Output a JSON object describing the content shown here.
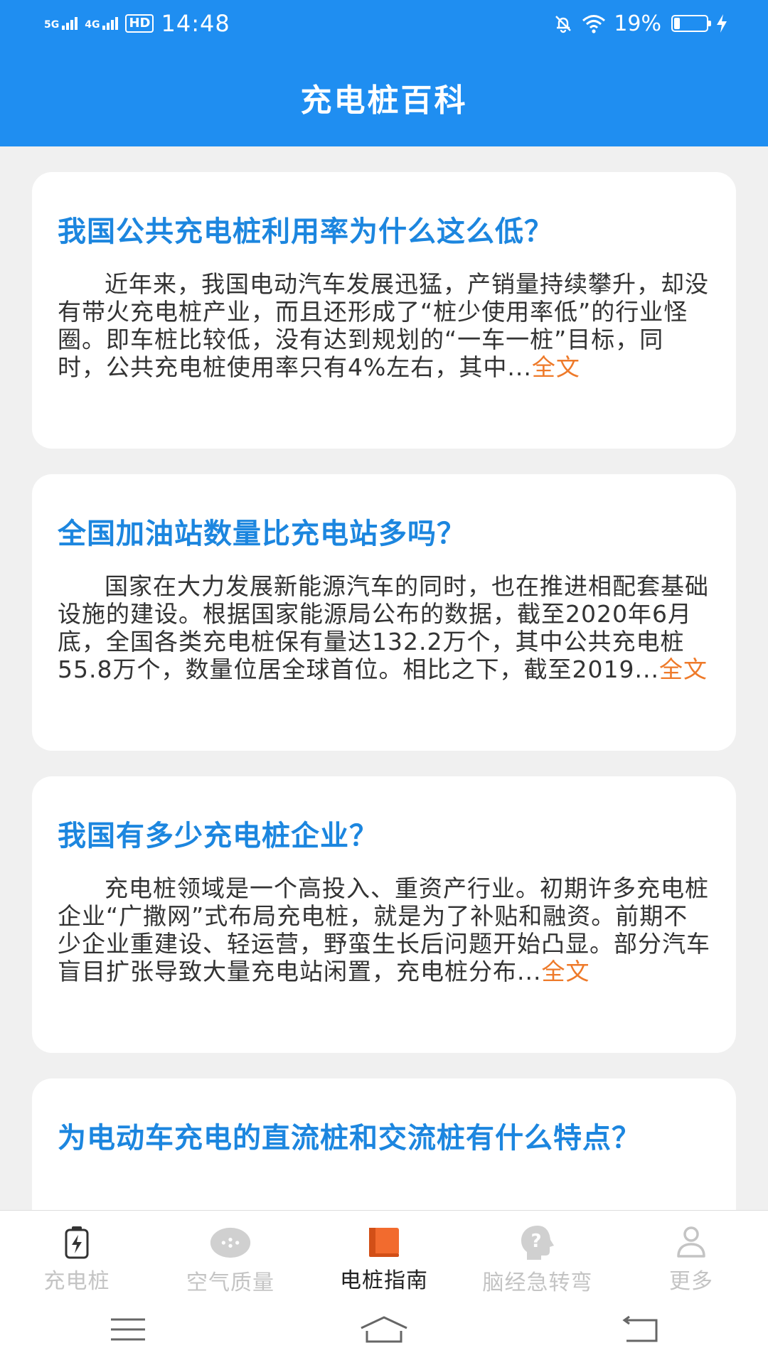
{
  "status_bar": {
    "network_1": "5G",
    "network_2": "4G",
    "hd_badge": "HD",
    "time": "14:48",
    "battery_text": "19%",
    "battery_level": 0.19
  },
  "header": {
    "title": "充电桩百科",
    "color": "#1f8ef1"
  },
  "articles": [
    {
      "title": "我国公共充电桩利用率为什么这么低？",
      "summary": "近年来，我国电动汽车发展迅猛，产销量持续攀升，却没有带火充电桩产业，而且还形成了“桩少使用率低”的行业怪圈。即车桩比较低，没有达到规划的“一车一桩”目标，同时，公共充电桩使用率只有4%左右，其中...",
      "more_label": "全文"
    },
    {
      "title": "全国加油站数量比充电站多吗？",
      "summary": "国家在大力发展新能源汽车的同时，也在推进相配套基础设施的建设。根据国家能源局公布的数据，截至2020年6月底，全国各类充电桩保有量达132.2万个，其中公共充电桩55.8万个，数量位居全球首位。相比之下，截至2019...",
      "more_label": "全文"
    },
    {
      "title": "我国有多少充电桩企业？",
      "summary": "充电桩领域是一个高投入、重资产行业。初期许多充电桩企业“广撒网”式布局充电桩，就是为了补贴和融资。前期不少企业重建设、轻运营，野蛮生长后问题开始凸显。部分汽车盲目扩张导致大量充电站闲置，充电桩分布...",
      "more_label": "全文"
    },
    {
      "title": "为电动车充电的直流桩和交流桩有什么特点？",
      "summary": "",
      "more_label": ""
    }
  ],
  "tabbar": {
    "tabs": [
      {
        "label": "充电桩",
        "icon": "charging-pile-icon",
        "active": false
      },
      {
        "label": "空气质量",
        "icon": "air-quality-icon",
        "active": false
      },
      {
        "label": "电桩指南",
        "icon": "book-icon",
        "active": true
      },
      {
        "label": "脑经急转弯",
        "icon": "brain-teaser-icon",
        "active": false
      },
      {
        "label": "更多",
        "icon": "person-icon",
        "active": false
      }
    ],
    "active_color": "#f26b2e",
    "inactive_color": "#c4c4c4"
  },
  "colors": {
    "title_blue": "#1c86df",
    "more_orange": "#ee7a2a",
    "background": "#f0f0f0"
  }
}
